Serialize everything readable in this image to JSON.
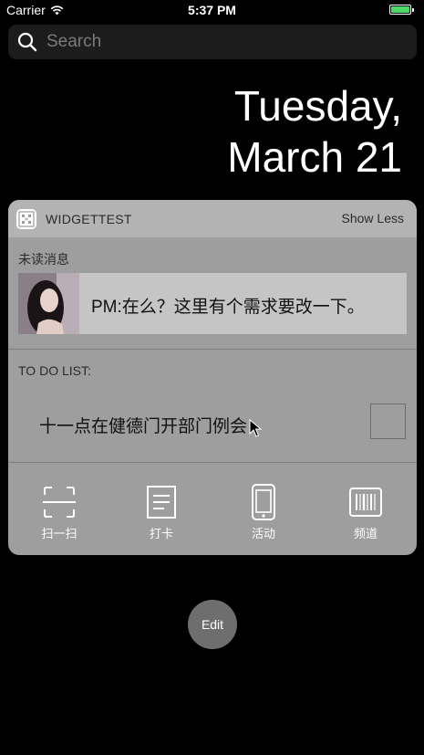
{
  "status_bar": {
    "carrier": "Carrier",
    "time": "5:37 PM"
  },
  "search": {
    "placeholder": "Search"
  },
  "date": {
    "line1": "Tuesday,",
    "line2": "March 21"
  },
  "widget": {
    "title": "WIDGETTEST",
    "show_less": "Show Less",
    "unread_label": "未读消息",
    "message": "PM:在么？这里有个需求要改一下。",
    "todo_label": "TO DO LIST:",
    "todo_item": "十一点在健德门开部门例会",
    "actions": [
      {
        "label": "扫一扫",
        "icon": "scan-icon"
      },
      {
        "label": "打卡",
        "icon": "document-icon"
      },
      {
        "label": "活动",
        "icon": "phone-icon"
      },
      {
        "label": "频道",
        "icon": "barcode-icon"
      }
    ]
  },
  "edit_button": {
    "label": "Edit"
  },
  "colors": {
    "background": "#000000",
    "widget_body": "#9e9e9e",
    "widget_header": "#b3b3b3",
    "battery": "#4cd964"
  }
}
